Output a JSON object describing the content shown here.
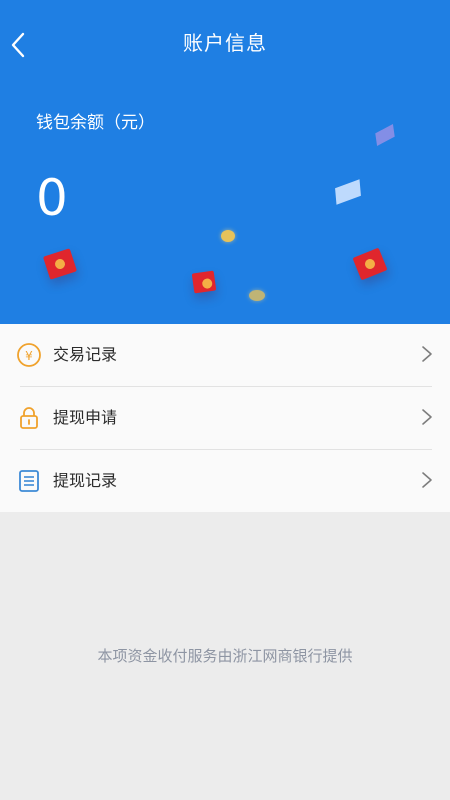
{
  "header": {
    "title": "账户信息",
    "balance_label": "钱包余额（元）",
    "balance_value": "0"
  },
  "menu": {
    "items": [
      {
        "label": "交易记录",
        "icon": "yuan-coin-icon"
      },
      {
        "label": "提现申请",
        "icon": "lock-icon"
      },
      {
        "label": "提现记录",
        "icon": "list-document-icon"
      }
    ]
  },
  "footer": {
    "note": "本项资金收付服务由浙江网商银行提供"
  },
  "colors": {
    "header_bg": "#1f7fe3",
    "icon_orange": "#f0a22c",
    "icon_blue": "#3d8ad6",
    "chevron": "#7d7d7d"
  }
}
